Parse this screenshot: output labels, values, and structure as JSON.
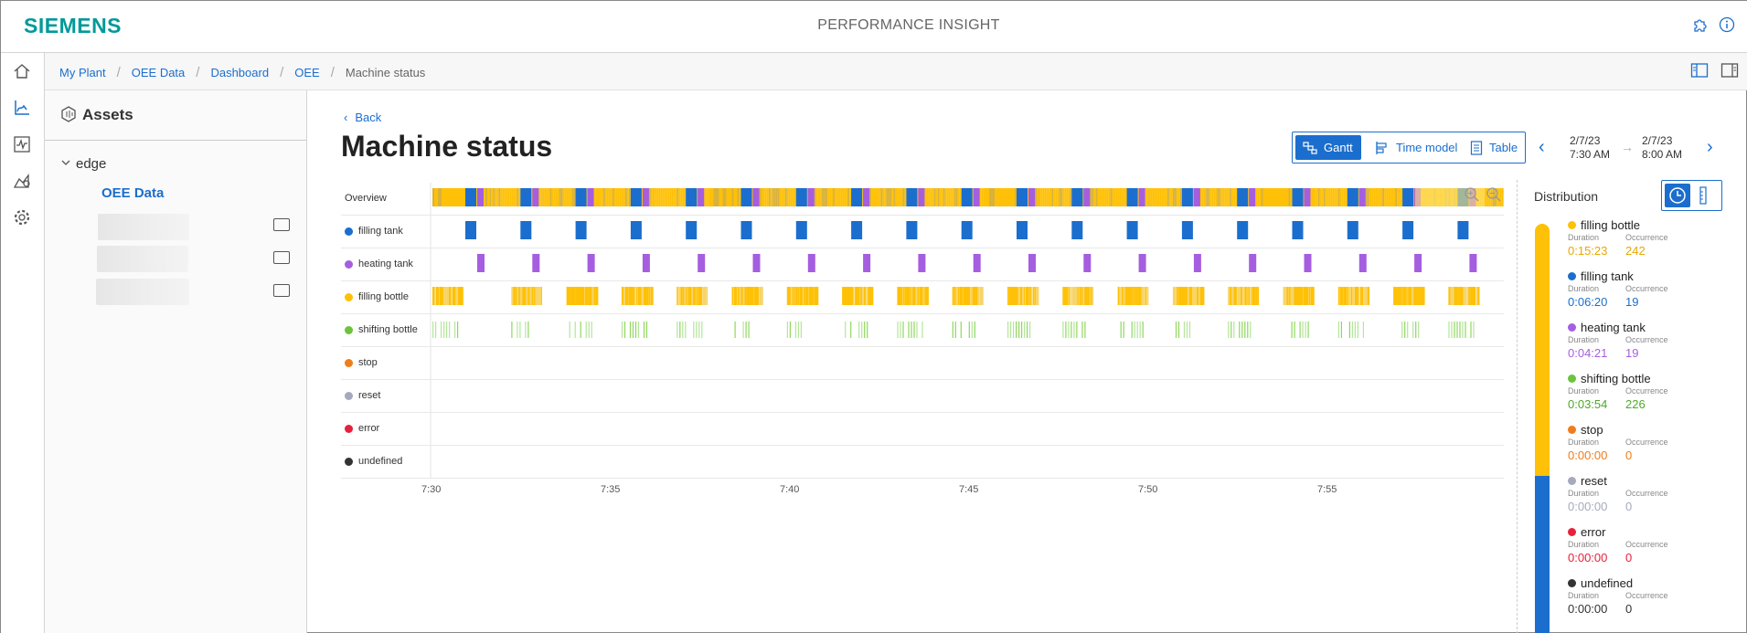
{
  "header": {
    "logo": "SIEMENS",
    "app_title": "PERFORMANCE INSIGHT"
  },
  "breadcrumb": [
    "My Plant",
    "OEE Data",
    "Dashboard",
    "OEE",
    "Machine status"
  ],
  "assets": {
    "title": "Assets",
    "tree_root": "edge",
    "tree_selected": "OEE Data"
  },
  "main": {
    "back_label": "Back",
    "page_title": "Machine status",
    "views": [
      "Gantt",
      "Time model",
      "Table"
    ],
    "active_view": "Gantt",
    "date_from": {
      "date": "2/7/23",
      "time": "7:30 AM"
    },
    "date_to": {
      "date": "2/7/23",
      "time": "8:00 AM"
    }
  },
  "gantt": {
    "overview_label": "Overview",
    "rows": [
      {
        "label": "filling tank",
        "color": "#1b6ecd"
      },
      {
        "label": "heating tank",
        "color": "#a55ee0"
      },
      {
        "label": "filling bottle",
        "color": "#ffc107"
      },
      {
        "label": "shifting bottle",
        "color": "#6cc43a"
      },
      {
        "label": "stop",
        "color": "#f07c1a"
      },
      {
        "label": "reset",
        "color": "#a5a9bd"
      },
      {
        "label": "error",
        "color": "#e8203b"
      },
      {
        "label": "undefined",
        "color": "#333333"
      }
    ],
    "x_ticks": [
      "7:30",
      "7:35",
      "7:40",
      "7:45",
      "7:50",
      "7:55"
    ]
  },
  "distribution": {
    "title": "Distribution",
    "duration_label": "Duration",
    "occurrence_label": "Occurrence",
    "items": [
      {
        "name": "filling bottle",
        "duration": "0:15:23",
        "occurrence": "242",
        "color": "#ffc107",
        "text_color": "#e8a800"
      },
      {
        "name": "filling tank",
        "duration": "0:06:20",
        "occurrence": "19",
        "color": "#1b6ecd",
        "text_color": "#1b6ecd"
      },
      {
        "name": "heating tank",
        "duration": "0:04:21",
        "occurrence": "19",
        "color": "#a55ee0",
        "text_color": "#a55ee0"
      },
      {
        "name": "shifting bottle",
        "duration": "0:03:54",
        "occurrence": "226",
        "color": "#6cc43a",
        "text_color": "#4fa82a"
      },
      {
        "name": "stop",
        "duration": "0:00:00",
        "occurrence": "0",
        "color": "#f07c1a",
        "text_color": "#f07c1a"
      },
      {
        "name": "reset",
        "duration": "0:00:00",
        "occurrence": "0",
        "color": "#a5a9bd",
        "text_color": "#a5a9bd"
      },
      {
        "name": "error",
        "duration": "0:00:00",
        "occurrence": "0",
        "color": "#e8203b",
        "text_color": "#e8203b"
      },
      {
        "name": "undefined",
        "duration": "0:00:00",
        "occurrence": "0",
        "color": "#333333",
        "text_color": "#333333"
      }
    ]
  }
}
